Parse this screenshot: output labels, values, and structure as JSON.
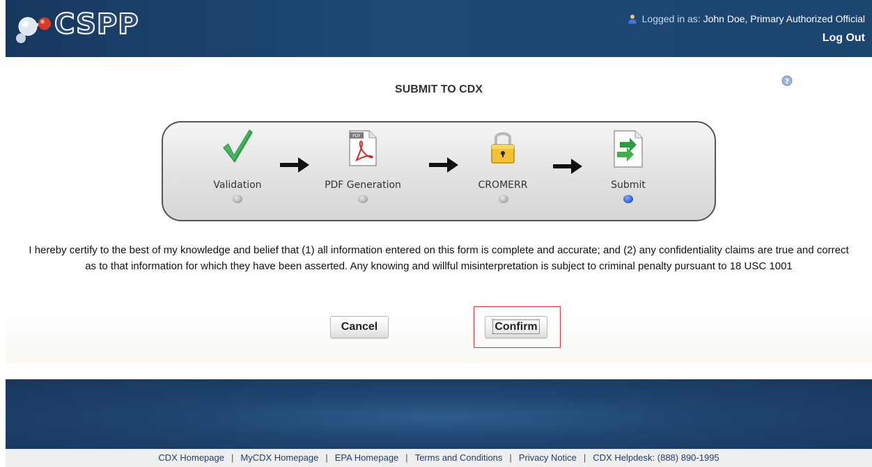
{
  "header": {
    "brand": "CSPP",
    "logged_in_prefix": "Logged in as:",
    "user_name": "John Doe, Primary Authorized Official",
    "logout_label": "Log Out"
  },
  "page": {
    "title": "SUBMIT TO CDX"
  },
  "steps": [
    {
      "label": "Validation",
      "icon": "checkmark-icon",
      "status": "inactive"
    },
    {
      "label": "PDF Generation",
      "icon": "pdf-icon",
      "status": "inactive"
    },
    {
      "label": "CROMERR",
      "icon": "lock-icon",
      "status": "inactive"
    },
    {
      "label": "Submit",
      "icon": "submit-document-icon",
      "status": "active"
    }
  ],
  "certification": {
    "text": "I hereby certify to the best of my knowledge and belief that (1) all information entered on this form is complete and accurate; and (2) any confidentiality claims are true and correct as to that information for which they have been asserted. Any knowing and willful misinterpretation is subject to criminal penalty pursuant to 18 USC 1001"
  },
  "actions": {
    "cancel_label": "Cancel",
    "confirm_label": "Confirm"
  },
  "footer": {
    "links": [
      "CDX Homepage",
      "MyCDX Homepage",
      "EPA Homepage",
      "Terms and Conditions",
      "Privacy Notice",
      "CDX Helpdesk: (888) 890-1995"
    ]
  },
  "colors": {
    "header_bg": "#1f4a78",
    "active_step_dot": "#2a5bc8",
    "highlight": "#e03a3a"
  }
}
